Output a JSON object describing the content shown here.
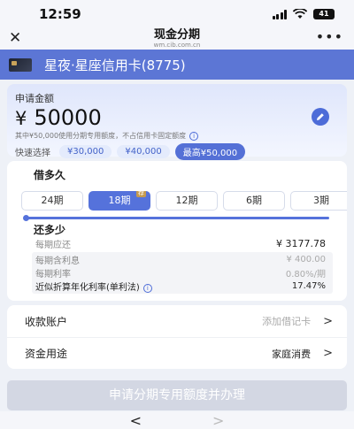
{
  "status_bar": {
    "time": "12:59",
    "battery": "41"
  },
  "nav": {
    "close": "✕",
    "title": "现金分期",
    "subtitle": "wm.cib.com.cn",
    "more": "•••"
  },
  "card": {
    "name": "星夜·星座信用卡(8775)"
  },
  "amount": {
    "label": "申请金额",
    "currency": "¥",
    "value": "50000",
    "hint": "其中¥50,000使用分期专用额度，不占信用卡固定额度",
    "quick_label": "快速选择",
    "quick_options": [
      "¥30,000",
      "¥40,000",
      "最高¥50,000"
    ],
    "selected_quick": "最高¥50,000"
  },
  "term": {
    "title": "借多久",
    "periods": [
      "24期",
      "18期",
      "12期",
      "6期",
      "3期"
    ],
    "selected": "18期",
    "recommend_badge": "荐"
  },
  "repayment": {
    "title": "还多少",
    "monthly_label": "每期应还",
    "monthly_value": "¥ 3177.78",
    "interest_label": "每期含利息",
    "interest_value": "¥ 400.00",
    "rate_label": "每期利率",
    "rate_value": "0.80%/期",
    "annual_label": "近似折算年化利率(单利法)",
    "annual_value": "17.47%"
  },
  "settings": {
    "account_label": "收款账户",
    "account_value": "添加借记卡",
    "purpose_label": "资金用途",
    "purpose_value": "家庭消费"
  },
  "submit": {
    "label": "申请分期专用额度并办理"
  },
  "bottom_nav": {
    "back": "<",
    "forward": ">"
  },
  "colors": {
    "accent": "#5572db",
    "header": "#5c76d5",
    "badge": "#c59a4f"
  }
}
